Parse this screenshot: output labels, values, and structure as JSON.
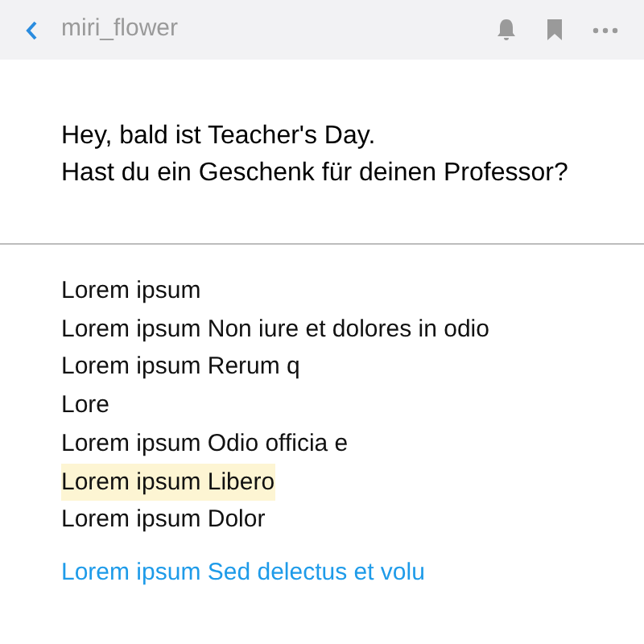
{
  "header": {
    "title": "miri_flower"
  },
  "message": [
    "Hey, bald ist Teacher's Day.",
    "Hast du ein Geschenk für deinen Professor?"
  ],
  "lines": [
    {
      "text": "Lorem ipsum",
      "highlighted": false
    },
    {
      "text": "Lorem ipsum Non iure et dolores in odio",
      "highlighted": false
    },
    {
      "text": "Lorem ipsum Rerum q",
      "highlighted": false
    },
    {
      "text": "Lore",
      "highlighted": false
    },
    {
      "text": "Lorem ipsum Odio officia e",
      "highlighted": false
    },
    {
      "text": "Lorem ipsum Libero",
      "highlighted": true
    },
    {
      "text": "Lorem ipsum Dolor",
      "highlighted": false
    }
  ],
  "link": "Lorem ipsum Sed delectus et volu"
}
